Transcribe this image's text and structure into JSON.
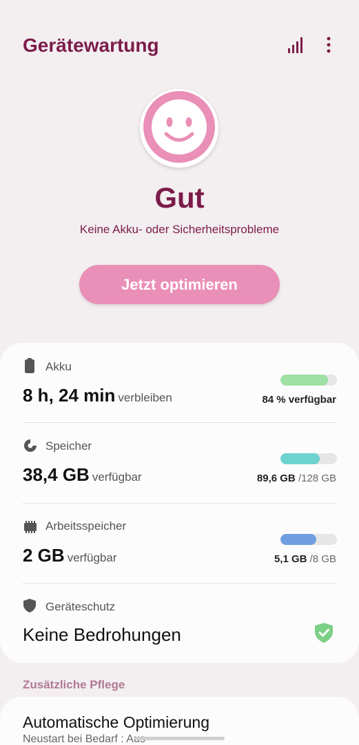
{
  "header": {
    "title": "Gerätewartung",
    "stats_icon": "bar-chart-icon",
    "more_icon": "more-vertical-icon"
  },
  "status": {
    "icon": "smiley-face-icon",
    "title": "Gut",
    "subtitle": "Keine Akku- oder Sicherheitsprobleme",
    "button_label": "Jetzt optimieren"
  },
  "battery": {
    "icon": "battery-icon",
    "label": "Akku",
    "value": "8 h, 24 min",
    "suffix": "verbleiben",
    "meta_value": "84 % verfügbar",
    "fill": 0.84,
    "color": "#9fe0a4"
  },
  "storage": {
    "icon": "pie-chart-icon",
    "label": "Speicher",
    "value": "38,4 GB",
    "suffix": "verfügbar",
    "used": "89,6 GB",
    "total": "/128 GB",
    "fill": 0.7,
    "color": "#6ed3cf"
  },
  "memory": {
    "icon": "memory-chip-icon",
    "label": "Arbeitsspeicher",
    "value": "2 GB",
    "suffix": "verfügbar",
    "used": "5,1 GB",
    "total": "/8 GB",
    "fill": 0.64,
    "color": "#6f9ee0"
  },
  "protection": {
    "icon": "shield-icon",
    "label": "Geräteschutz",
    "value": "Keine Bedrohungen",
    "status_icon": "shield-check-icon",
    "status_color": "#7bcf86"
  },
  "extra": {
    "heading": "Zusätzliche Pflege",
    "auto_title": "Automatische Optimierung",
    "auto_subtitle": "Neustart bei Bedarf : Aus"
  },
  "colors": {
    "accent": "#7b1c4a",
    "button": "#ea8fb7",
    "background": "#f3eef0"
  }
}
